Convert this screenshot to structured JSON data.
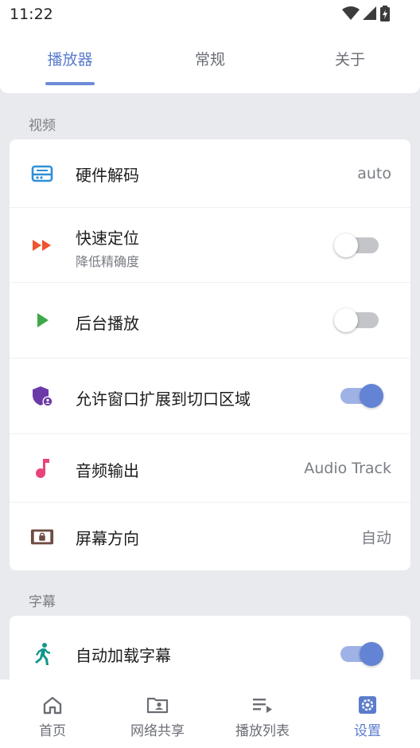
{
  "status_bar": {
    "time": "11:22"
  },
  "tabs": [
    {
      "label": "播放器",
      "active": true
    },
    {
      "label": "常规",
      "active": false
    },
    {
      "label": "关于",
      "active": false
    }
  ],
  "sections": {
    "video": {
      "label": "视频",
      "rows": [
        {
          "title": "硬件解码",
          "value": "auto",
          "icon": "hardware-decode-icon"
        },
        {
          "title": "快速定位",
          "subtitle": "降低精确度",
          "toggle": "off",
          "icon": "fast-forward-icon"
        },
        {
          "title": "后台播放",
          "toggle": "off",
          "icon": "play-icon"
        },
        {
          "title": "允许窗口扩展到切口区域",
          "toggle": "on",
          "icon": "shield-user-icon"
        },
        {
          "title": "音频输出",
          "value": "Audio Track",
          "icon": "music-note-icon"
        },
        {
          "title": "屏幕方向",
          "value": "自动",
          "icon": "screen-rotation-lock-icon"
        }
      ]
    },
    "subtitle": {
      "label": "字幕",
      "rows": [
        {
          "title": "自动加载字幕",
          "toggle": "on",
          "icon": "running-person-icon"
        }
      ]
    }
  },
  "bottom_nav": [
    {
      "label": "首页",
      "icon": "home-icon",
      "active": false
    },
    {
      "label": "网络共享",
      "icon": "network-share-folder-icon",
      "active": false
    },
    {
      "label": "播放列表",
      "icon": "playlist-icon",
      "active": false
    },
    {
      "label": "设置",
      "icon": "settings-gear-icon",
      "active": true
    }
  ],
  "colors": {
    "accent": "#5b7ccc",
    "background": "#e9eaed",
    "hardware_icon": "#2f8fd8",
    "fast_forward_icon": "#f0532d",
    "play_icon": "#3da84a",
    "shield_icon": "#6c3aa8",
    "music_icon": "#e8437a",
    "screen_icon": "#6d4c41",
    "running_icon": "#12968a"
  }
}
